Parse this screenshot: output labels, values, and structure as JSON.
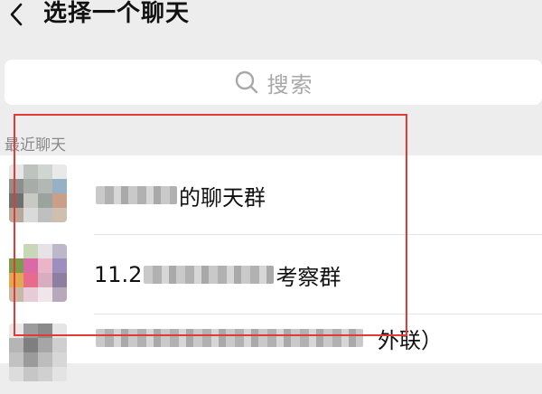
{
  "header": {
    "title": "选择一个聊天",
    "back_icon": "chevron-left-icon"
  },
  "search": {
    "placeholder": "搜索",
    "icon": "search-icon"
  },
  "recent": {
    "label": "最近聊天",
    "items": [
      {
        "name_visible": "的聊天群"
      },
      {
        "name_prefix": "11.2",
        "name_suffix": "考察群"
      },
      {
        "name_suffix": "外联）"
      }
    ]
  },
  "colors": {
    "background": "#ededed",
    "highlight_border": "#e53935"
  }
}
